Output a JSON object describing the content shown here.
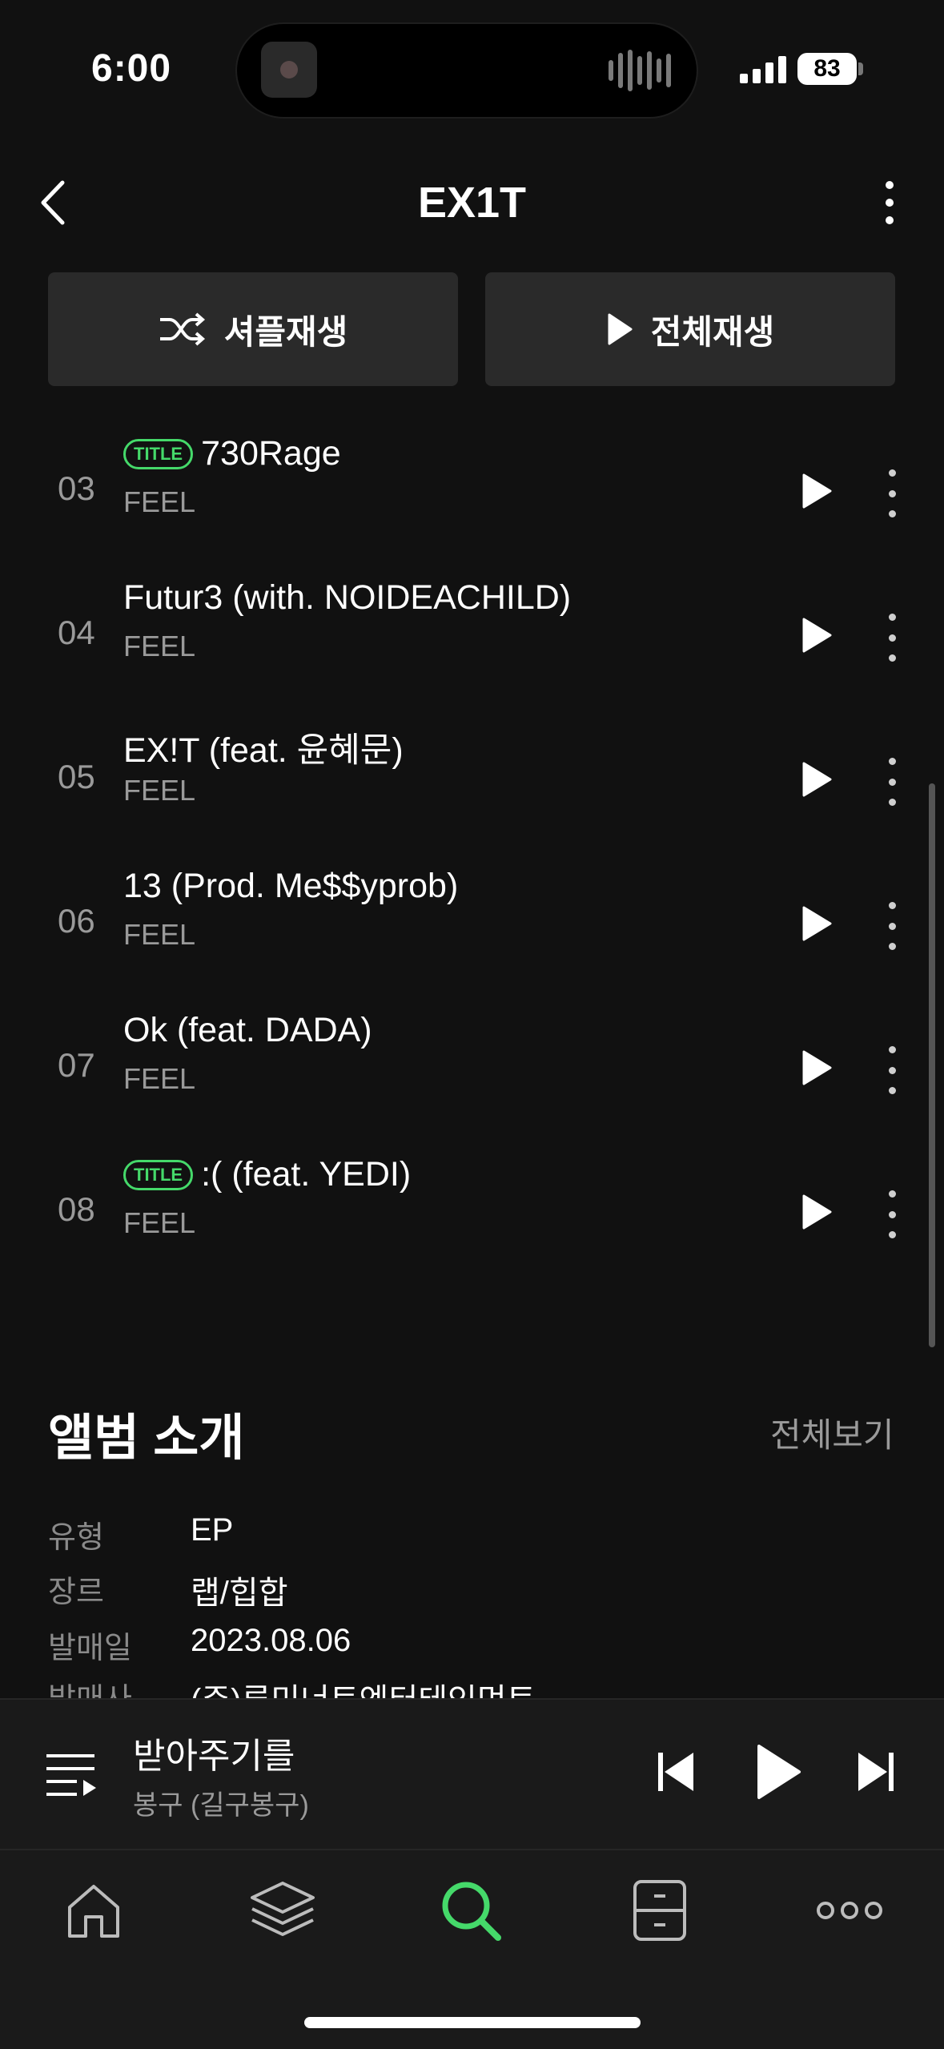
{
  "status_bar": {
    "time": "6:00",
    "battery": "83"
  },
  "header": {
    "title": "EX1T"
  },
  "actions": {
    "shuffle_label": "셔플재생",
    "play_all_label": "전체재생"
  },
  "tracks": [
    {
      "num": "03",
      "title": "730Rage",
      "artist": "FEEL",
      "badge": "TITLE"
    },
    {
      "num": "04",
      "title": "Futur3 (with. NOIDEACHILD)",
      "artist": "FEEL",
      "badge": ""
    },
    {
      "num": "05",
      "title": "EX!T (feat. 윤혜문)",
      "artist": "FEEL",
      "badge": ""
    },
    {
      "num": "06",
      "title": "13 (Prod. Me$$yprob)",
      "artist": "FEEL",
      "badge": ""
    },
    {
      "num": "07",
      "title": "Ok (feat. DADA)",
      "artist": "FEEL",
      "badge": ""
    },
    {
      "num": "08",
      "title": ":( (feat. YEDI)",
      "artist": "FEEL",
      "badge": "TITLE"
    }
  ],
  "album_intro": {
    "title": "앨범 소개",
    "view_all": "전체보기",
    "info": [
      {
        "label": "유형",
        "value": "EP"
      },
      {
        "label": "장르",
        "value": "랩/힙합"
      },
      {
        "label": "발매일",
        "value": "2023.08.06"
      },
      {
        "label": "발매사",
        "value": "(주)루미너트엔터테인먼트"
      }
    ]
  },
  "mini_player": {
    "title": "받아주기를",
    "artist": "봉구 (길구봉구)"
  },
  "colors": {
    "accent": "#45d96a",
    "background": "#111111",
    "surface": "#2a2a2a"
  },
  "tab_bar": {
    "icons": [
      "home-icon",
      "layers-icon",
      "search-icon",
      "locker-icon",
      "more-icon"
    ],
    "active": "search-icon"
  }
}
